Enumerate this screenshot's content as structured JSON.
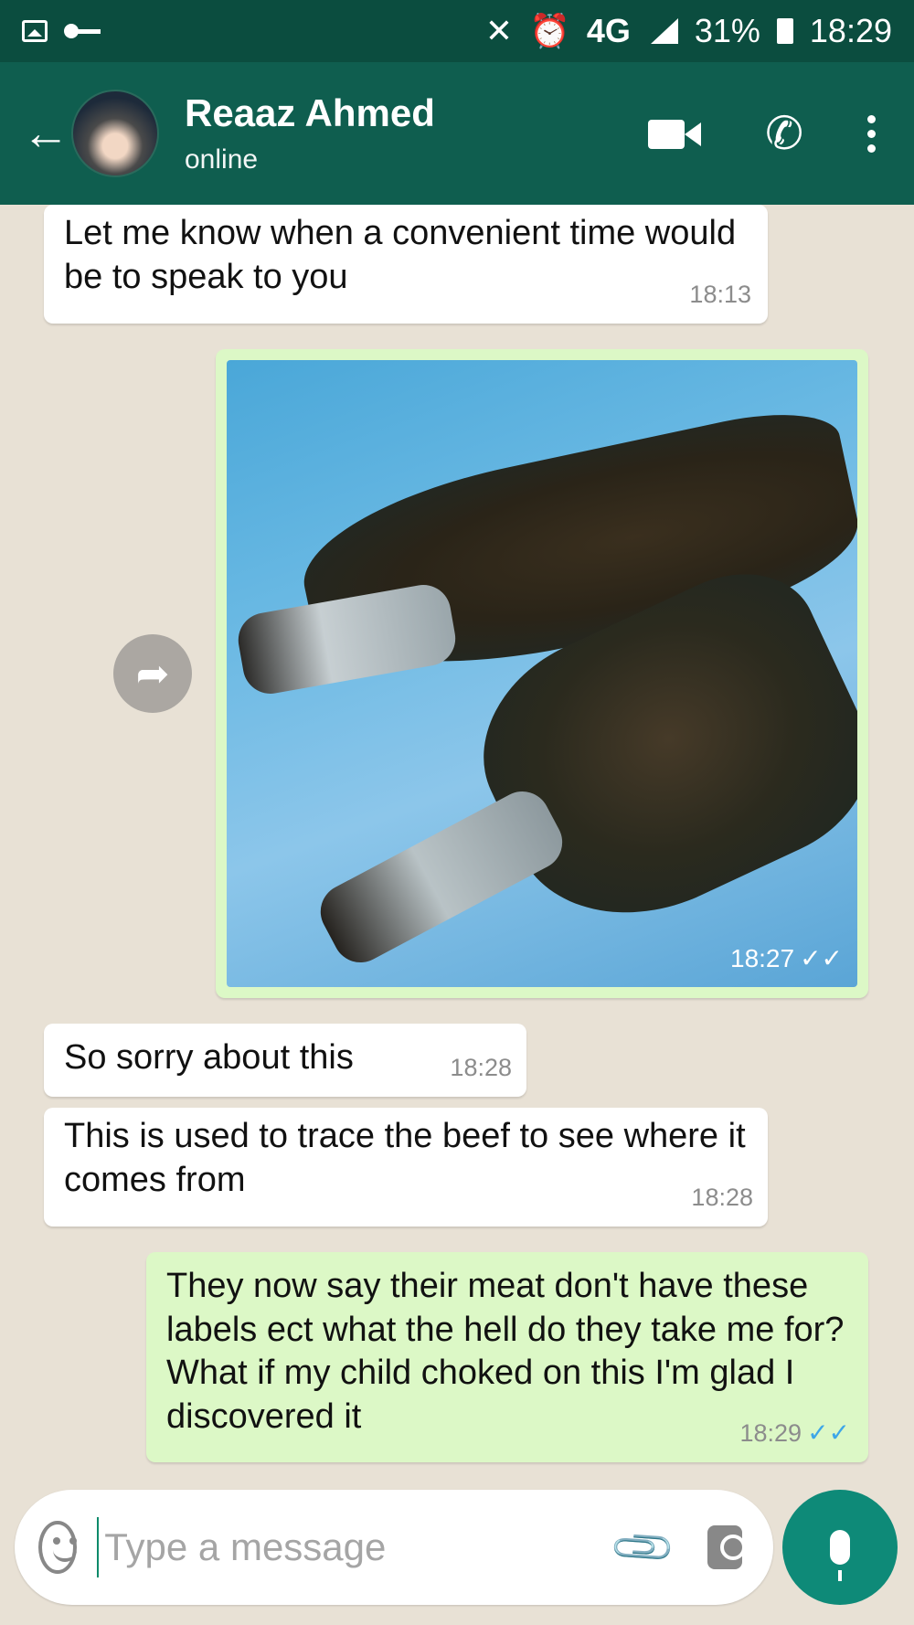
{
  "status_bar": {
    "network": "4G",
    "battery": "31%",
    "time": "18:29",
    "icons": [
      "gallery-icon",
      "key-icon",
      "mute-icon",
      "alarm-icon",
      "signal-icon",
      "battery-icon"
    ]
  },
  "header": {
    "back_icon": "back-arrow-icon",
    "contact_name": "Reaaz Ahmed",
    "contact_status": "online",
    "actions": [
      "video-call-icon",
      "phone-call-icon",
      "more-options-icon"
    ]
  },
  "messages": [
    {
      "direction": "incoming",
      "text": "Let me know when a convenient time would be to speak to you",
      "time": "18:13"
    },
    {
      "direction": "outgoing",
      "type": "image",
      "time": "18:27",
      "status": "read"
    },
    {
      "direction": "incoming",
      "text": "So sorry about this",
      "time": "18:28"
    },
    {
      "direction": "incoming",
      "text": "This is used to trace the beef to see where it comes from",
      "time": "18:28"
    },
    {
      "direction": "outgoing",
      "text": "They now say their meat don't have these labels ect what the hell do they take me for? What if my child choked on this I'm glad I discovered it",
      "time": "18:29",
      "status": "read"
    }
  ],
  "input": {
    "placeholder": "Type a message",
    "value": ""
  },
  "colors": {
    "header": "#0f5e4f",
    "status_bar": "#0b4d3f",
    "outgoing_bubble": "#dcf8c6",
    "incoming_bubble": "#ffffff",
    "read_tick": "#3da6e8",
    "mic_button": "#0e8a78"
  }
}
